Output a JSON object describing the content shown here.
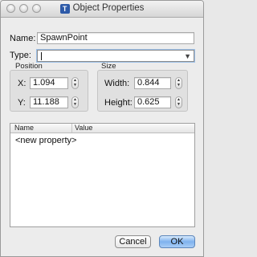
{
  "window": {
    "title": "Object Properties",
    "app_icon_letter": "T"
  },
  "form": {
    "name_label": "Name:",
    "name_value": "SpawnPoint",
    "type_label": "Type:",
    "type_value": ""
  },
  "position": {
    "title": "Position",
    "x_label": "X:",
    "x_value": "1.094",
    "y_label": "Y:",
    "y_value": "11.188"
  },
  "size": {
    "title": "Size",
    "width_label": "Width:",
    "width_value": "0.844",
    "height_label": "Height:",
    "height_value": "0.625"
  },
  "properties": {
    "columns": [
      "Name",
      "Value"
    ],
    "rows": [
      "<new property>"
    ]
  },
  "buttons": {
    "cancel": "Cancel",
    "ok": "OK"
  }
}
